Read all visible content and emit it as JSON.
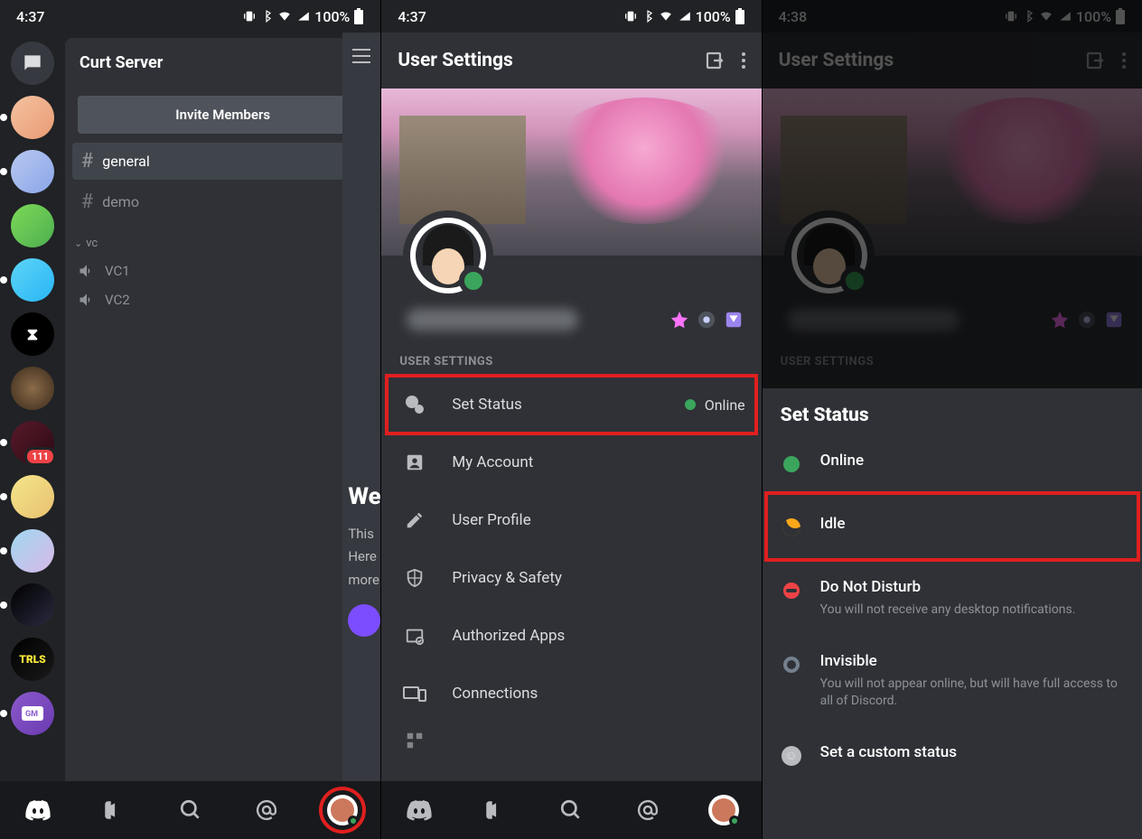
{
  "statusbar": {
    "time_a": "4:37",
    "time_b": "4:37",
    "time_c": "4:38",
    "battery": "100%"
  },
  "s1": {
    "server_name": "Curt Server",
    "invite": "Invite Members",
    "channels": {
      "general": "general",
      "demo": "demo"
    },
    "vc_header": "vc",
    "vc": {
      "a": "VC1",
      "b": "VC2"
    },
    "peek_title": "We",
    "peek_l1": "This",
    "peek_l2": "Here",
    "peek_l3": "more",
    "badge_111": "111"
  },
  "s2": {
    "title": "User Settings",
    "section": "USER SETTINGS",
    "rows": {
      "status": "Set Status",
      "status_val": "Online",
      "account": "My Account",
      "profile": "User Profile",
      "privacy": "Privacy & Safety",
      "apps": "Authorized Apps",
      "conn": "Connections"
    }
  },
  "s3": {
    "title": "User Settings",
    "section": "USER SETTINGS",
    "sheet_title": "Set Status",
    "online": "Online",
    "idle": "Idle",
    "dnd": "Do Not Disturb",
    "dnd_sub": "You will not receive any desktop notifications.",
    "inv": "Invisible",
    "inv_sub": "You will not appear online, but will have full access to all of Discord.",
    "custom": "Set a custom status"
  }
}
